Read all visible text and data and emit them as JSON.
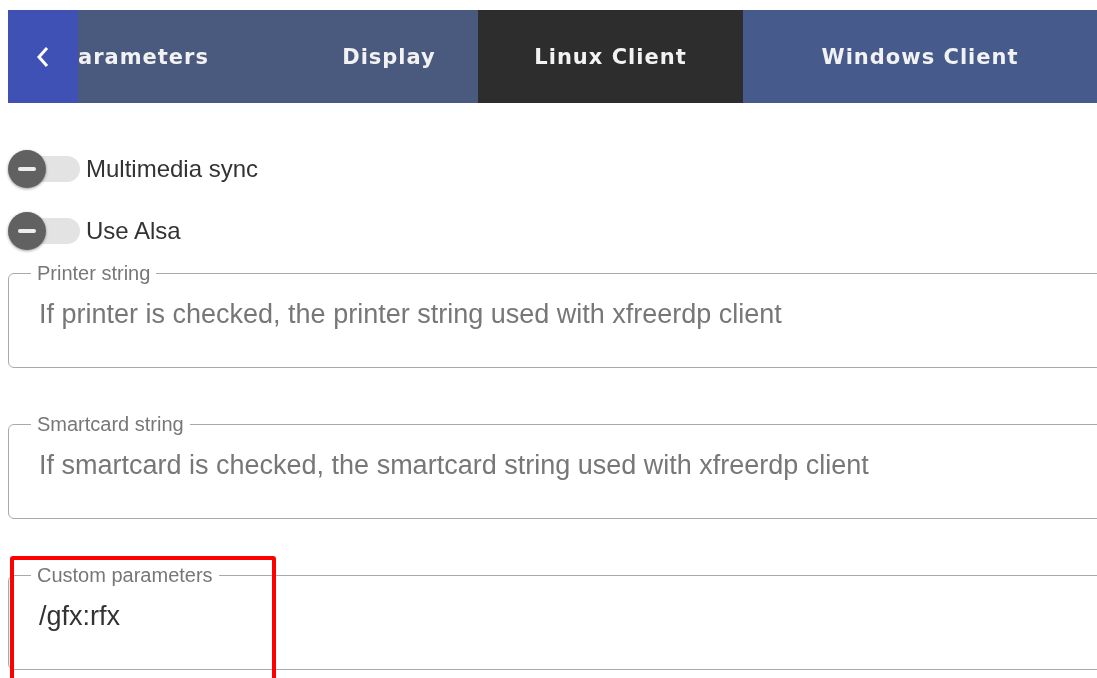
{
  "tabs": [
    {
      "label": "arameters",
      "selected": false
    },
    {
      "label": "Display",
      "selected": false
    },
    {
      "label": "Linux Client",
      "selected": true
    },
    {
      "label": "Windows Client",
      "selected": false
    }
  ],
  "toggles": [
    {
      "label": "Multimedia sync",
      "on": false
    },
    {
      "label": "Use Alsa",
      "on": false
    }
  ],
  "fields": [
    {
      "label": "Printer string",
      "placeholder": "If printer is checked, the printer string used with xfreerdp client",
      "highlighted": false
    },
    {
      "label": "Smartcard string",
      "placeholder": "If smartcard is checked, the smartcard string used with xfreerdp client",
      "highlighted": false
    },
    {
      "label": "Custom parameters",
      "value": "/gfx:rfx",
      "highlighted": true
    }
  ]
}
